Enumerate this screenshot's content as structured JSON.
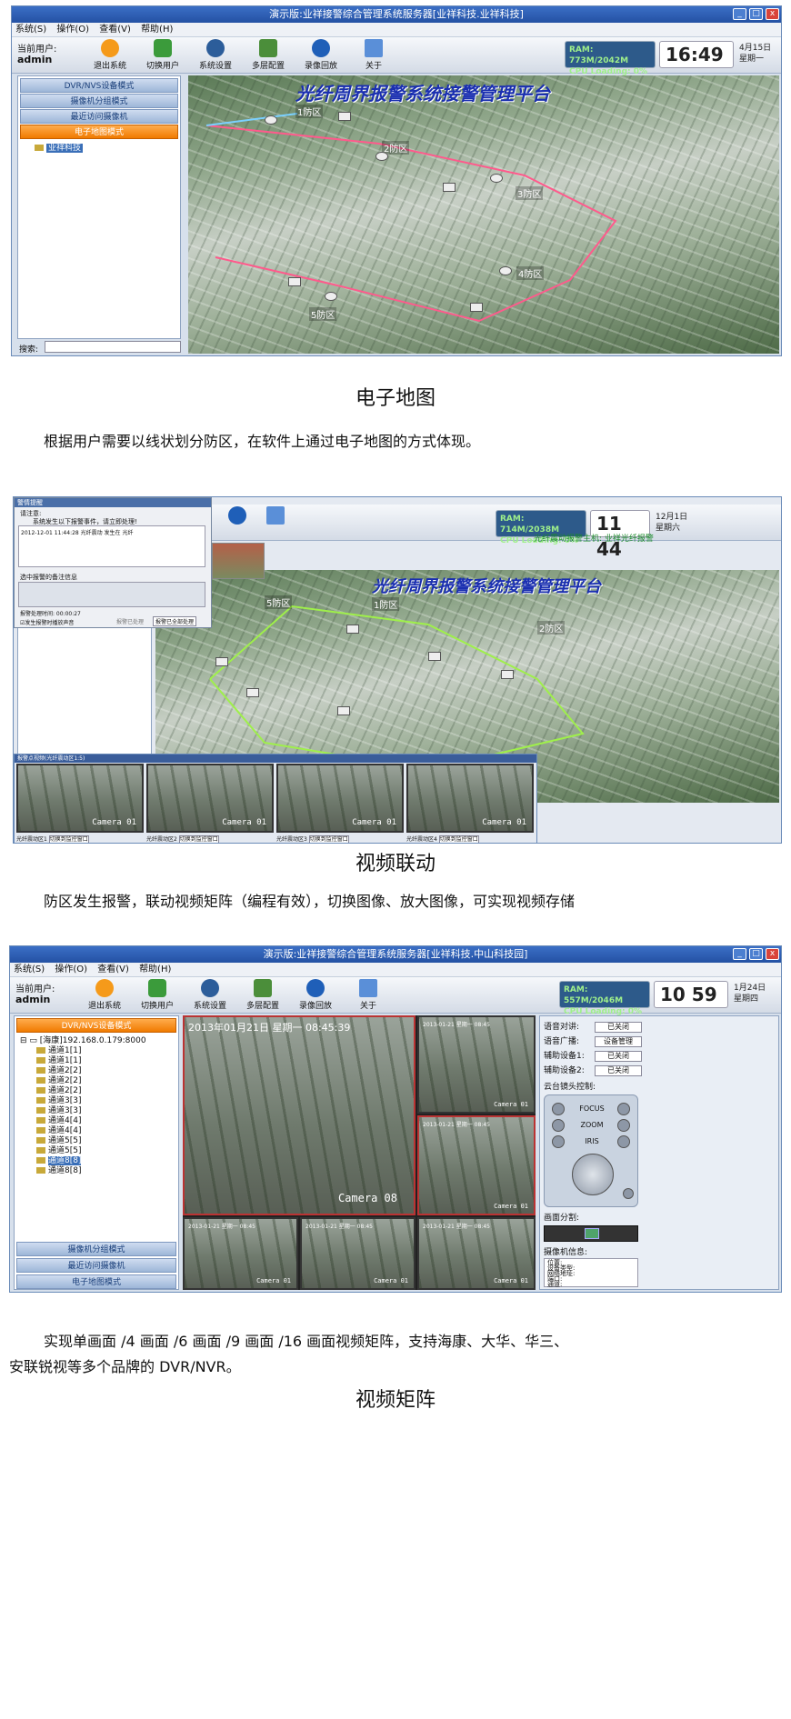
{
  "section1": {
    "window_title": "演示版:业祥接警综合管理系统服务器[业祥科技.业祥科技]",
    "menu": [
      "系统(S)",
      "操作(O)",
      "查看(V)",
      "帮助(H)"
    ],
    "user_label": "当前用户:",
    "user_name": "admin",
    "toolbar": [
      "退出系统",
      "切换用户",
      "系统设置",
      "多层配置",
      "录像回放",
      "关于"
    ],
    "ram": "RAM: 773M/2042M",
    "cpu": "CPU Loading: 0%",
    "clock": "16:49",
    "date": "4月15日",
    "weekday": "星期一",
    "nav": [
      "DVR/NVS设备模式",
      "摄像机分组模式",
      "最近访问摄像机",
      "电子地图模式"
    ],
    "tree_item": "业祥科技",
    "search_label": "搜索:",
    "map_title": "光纤周界报警系统接警管理平台",
    "zones": [
      "1防区",
      "2防区",
      "3防区",
      "4防区",
      "5防区"
    ],
    "caption": "电子地图",
    "desc": "根据用户需要以线状划分防区，在软件上通过电子地图的方式体现。"
  },
  "section2": {
    "popup_title": "警情提醒",
    "popup_line1": "请注意:",
    "popup_line2": "系统发生以下报警事件，请立即处理!",
    "popup_event": "2012-12-01 11:44:28  光纤震动  发生在 光纤",
    "popup_note": "选中报警的备注信息",
    "popup_time": "报警处理时间: 00:00:27",
    "popup_check": "发生报警时播放声音",
    "popup_btn1": "报警已处理",
    "popup_btn2": "报警已全部处理",
    "ram": "RAM: 714M/2038M",
    "cpu": "CPU Loading: 0%",
    "clock": "11 44",
    "date": "12月1日",
    "weekday": "星期六",
    "alert_text": "光纤震动报警主机: 业祥光纤报警",
    "map_title": "光纤周界报警系统接警管理平台",
    "zones": [
      "5防区",
      "1防区",
      "2防区"
    ],
    "strip_title": "报警点视频(光纤震动区1:5)",
    "feed_labels": [
      "光纤震动区1",
      "光纤震动区2",
      "光纤震动区3",
      "光纤震动区4"
    ],
    "feed_btn": "切换到监控窗口",
    "feed_cam": "Camera 01",
    "caption": "视频联动",
    "desc": "防区发生报警，联动视频矩阵（编程有效），切换图像、放大图像，可实现视频存储"
  },
  "section3": {
    "window_title": "演示版:业祥接警综合管理系统服务器[业祥科技.中山科技园]",
    "menu": [
      "系统(S)",
      "操作(O)",
      "查看(V)",
      "帮助(H)"
    ],
    "user_label": "当前用户:",
    "user_name": "admin",
    "toolbar": [
      "退出系统",
      "切换用户",
      "系统设置",
      "多层配置",
      "录像回放",
      "关于"
    ],
    "ram": "RAM: 557M/2046M",
    "cpu": "CPU Loading: 0%",
    "clock": "10 59",
    "date": "1月24日",
    "weekday": "星期四",
    "nav_active": "DVR/NVS设备模式",
    "tree_root": "[海康]192.168.0.179:8000",
    "channels": [
      "通道1[1]",
      "通道1[1]",
      "通道2[2]",
      "通道2[2]",
      "通道2[2]",
      "通道3[3]",
      "通道3[3]",
      "通道4[4]",
      "通道4[4]",
      "通道5[5]",
      "通道5[5]",
      "通道8[8]",
      "通道8[8]"
    ],
    "nav_bottom": [
      "摄像机分组模式",
      "最近访问摄像机",
      "电子地图模式"
    ],
    "main_stamp": "2013年01月21日 星期一 08:45:39",
    "main_cam": "Camera 08",
    "small_cam": "Camera 01",
    "small_stamp": "2013-01-21 星期一 08:45",
    "right": {
      "voice_talk": "语音对讲:",
      "voice_talk_btn": "已关闭",
      "voice_bc": "语音广播:",
      "voice_bc_btn": "设备管理",
      "aux1": "辅助设备1:",
      "aux1_btn": "已关闭",
      "aux2": "辅助设备2:",
      "aux2_btn": "已关闭",
      "ptz_title": "云台镜头控制:",
      "ptz": [
        "FOCUS",
        "ZOOM",
        "IRIS"
      ],
      "split_title": "画面分割:",
      "info_title": "摄像机信息:",
      "info": [
        "位置:",
        "设备类型:",
        "网络地址:",
        "端口:",
        "通道:"
      ]
    },
    "desc_line1": "实现单画面 /4 画面 /6 画面 /9 画面 /16 画面视频矩阵，支持海康、大华、华三、",
    "desc_line2": "安联锐视等多个品牌的 DVR/NVR。",
    "caption": "视频矩阵"
  }
}
